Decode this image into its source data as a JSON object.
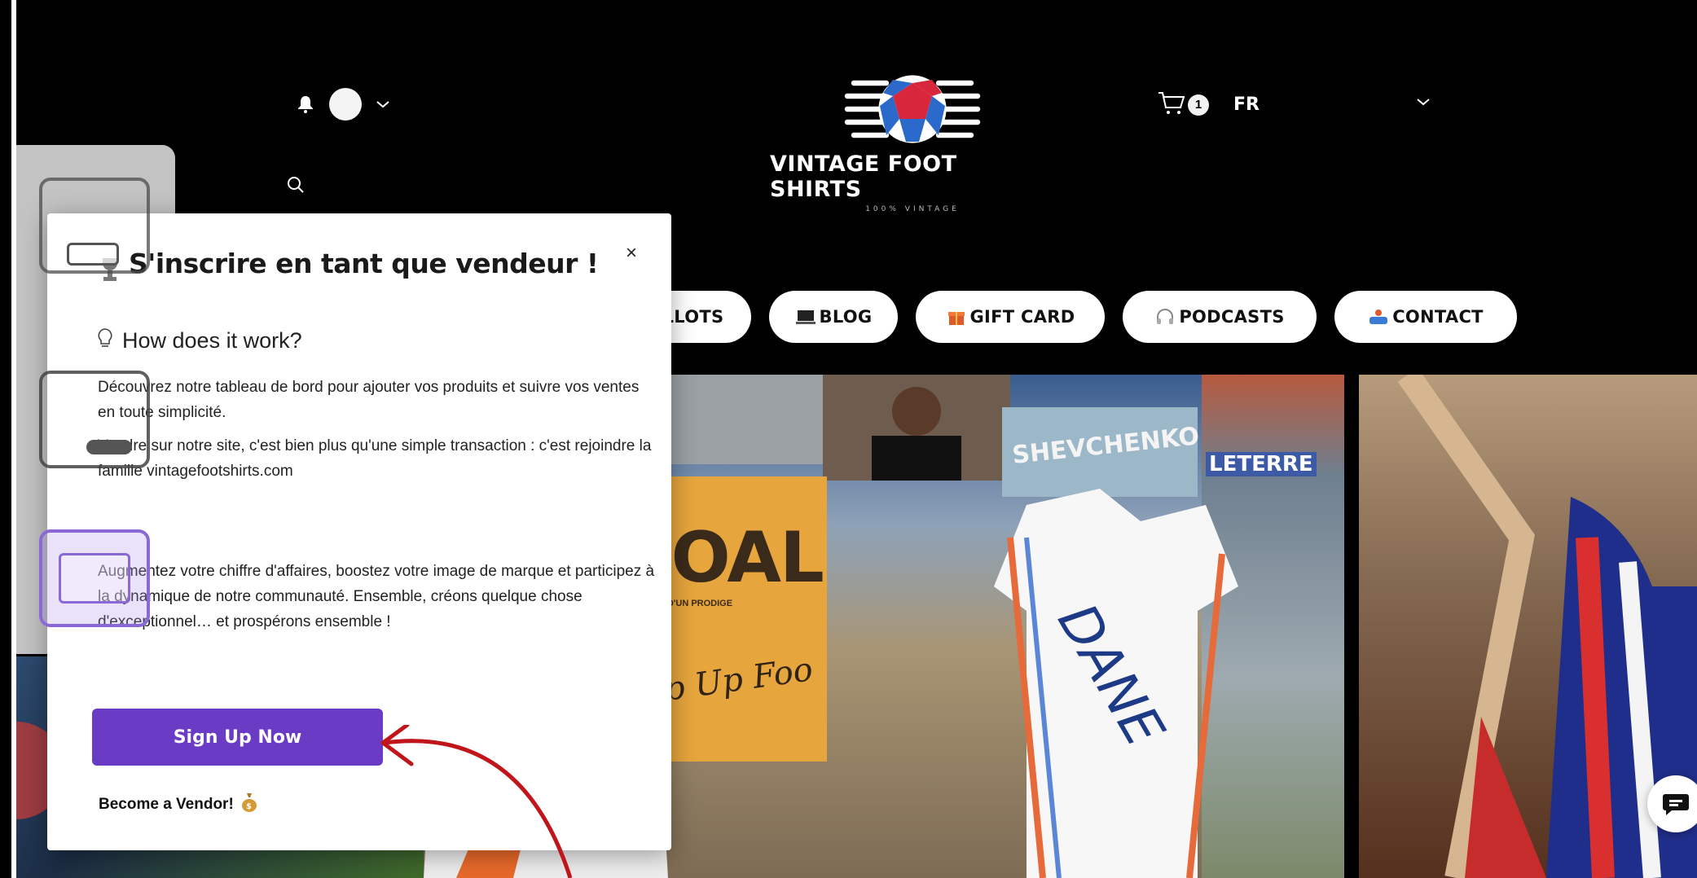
{
  "header": {
    "logo": {
      "title": "VINTAGE FOOT SHIRTS",
      "subtitle": "100% VINTAGE"
    },
    "cart_count": "1",
    "language": "FR"
  },
  "nav": {
    "items": [
      {
        "label": "LLOTS",
        "icon": ""
      },
      {
        "label": "BLOG",
        "icon": "laptop-icon"
      },
      {
        "label": "GIFT CARD",
        "icon": "gift-icon"
      },
      {
        "label": "PODCASTS",
        "icon": "headphones-icon"
      },
      {
        "label": "CONTACT",
        "icon": "contact-icon"
      }
    ]
  },
  "modal": {
    "title": "S'inscrire en tant que vendeur !",
    "how_heading": "How does it work?",
    "paragraph_1": "Découvrez notre tableau de bord pour ajouter vos produits et suivre vos ventes en toute simplicité.",
    "paragraph_2": "Vendre sur notre site, c'est bien plus qu'une simple transaction : c'est rejoindre la famille vintagefootshirts.com",
    "paragraph_3": "Augmentez votre chiffre d'affaires, boostez votre image de marque et participez à la dynamique de notre communauté. Ensemble, créons quelque chose d'exceptionnel… et prospérons ensemble !",
    "signup_label": "Sign Up Now",
    "vendor_label": "Become a Vendor!",
    "close_label": "×"
  },
  "hero": {
    "goal_title": "GOAL",
    "goal_subtitle": "NAISSANCE D'UN PRODIGE",
    "goal_script": "Pop Up Foo",
    "poster_name": "SHEVCHENKO",
    "poster_name_2": "LETERRE",
    "jersey_name": "DANE"
  },
  "colors": {
    "accent": "#6a3bc4",
    "background": "#000000",
    "annotation_arrow": "#c0161b"
  }
}
